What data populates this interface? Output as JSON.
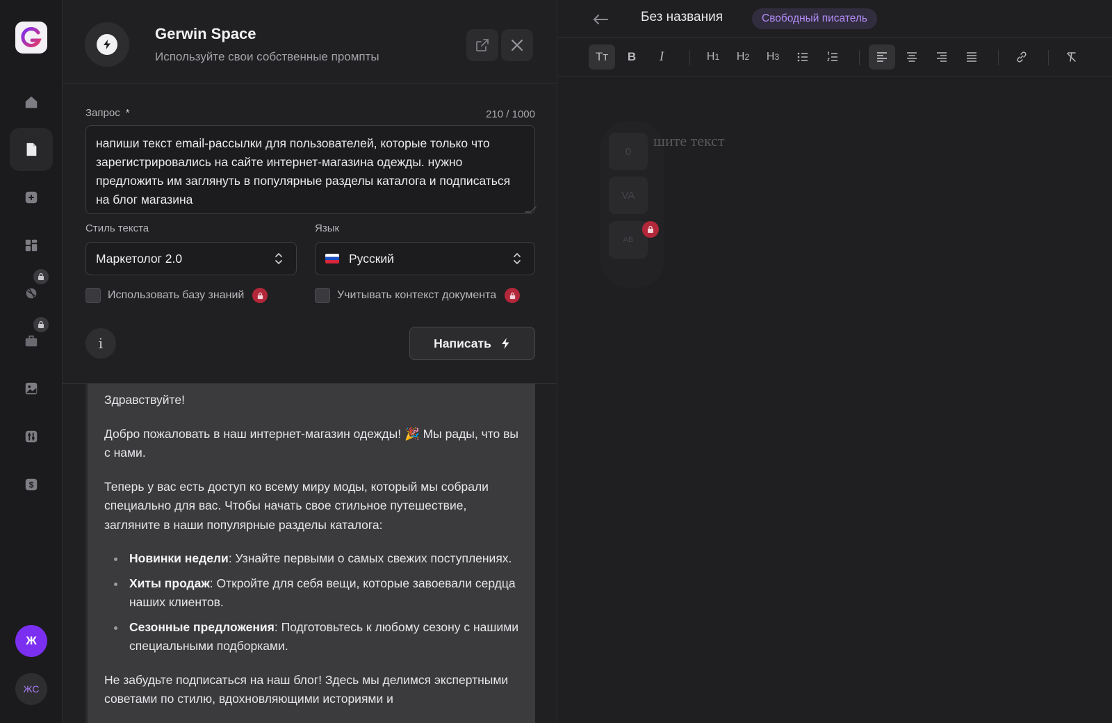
{
  "panel": {
    "title": "Gerwin Space",
    "subtitle": "Используйте свои собственные промпты"
  },
  "form": {
    "prompt_label": "Запрос",
    "prompt_required": "*",
    "counter": "210 / 1000",
    "prompt_value": "напиши текст email-рассылки для пользователей, которые только что зарегистрировались на сайте интернет-магазина одежды. нужно предложить им заглянуть в популярные разделы каталога и подписаться на блог магазина",
    "style_label": "Стиль текста",
    "style_value": "Маркетолог 2.0",
    "lang_label": "Язык",
    "lang_value": "Русский",
    "kb_label": "Использовать базу знаний",
    "ctx_label": "Учитывать контекст документа",
    "info_glyph": "i",
    "write_label": "Написать"
  },
  "result": {
    "greeting": "Здравствуйте!",
    "p1": "Добро пожаловать в наш интернет-магазин одежды! 🎉 Мы рады, что вы с нами.",
    "p2": "Теперь у вас есть доступ ко всему миру моды, который мы собрали специально для вас. Чтобы начать свое стильное путешествие, загляните в наши популярные разделы каталога:",
    "items": [
      {
        "title": "Новинки недели",
        "text": ": Узнайте первыми о самых свежих поступлениях."
      },
      {
        "title": "Хиты продаж",
        "text": ": Откройте для себя вещи, которые завоевали сердца наших клиентов."
      },
      {
        "title": "Сезонные предложения",
        "text": ": Подготовьтесь к любому сезону с нашими специальными подборками."
      }
    ],
    "p3": "Не забудьте подписаться на наш блог! Здесь мы делимся экспертными советами по стилю, вдохновляющими историями и"
  },
  "editor": {
    "doc_title": "Без названия",
    "badge": "Свободный писатель",
    "placeholder": "шите текст",
    "word_count": "0",
    "toolbar": {
      "text_style": "Tт",
      "bold": "B",
      "italic": "I",
      "h1": "H",
      "h2": "H",
      "h3": "H",
      "h1_sub": "1",
      "h2_sub": "2",
      "h3_sub": "3"
    },
    "float_va": "VA",
    "float_ab": "AB"
  },
  "user": {
    "avatar_initial": "Ж",
    "workspace_initials": "ЖС"
  },
  "colors": {
    "accent": "#7b2ff0",
    "badge_text": "#b38cf7",
    "lock": "#b2273a",
    "background": "#1e1e20"
  }
}
